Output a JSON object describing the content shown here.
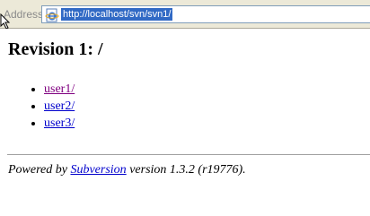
{
  "addressbar": {
    "label": "Address",
    "url": "http://localhost/svn/svn1/"
  },
  "page": {
    "title": "Revision 1: /",
    "entries": [
      {
        "label": "user1/",
        "visited": true
      },
      {
        "label": "user2/",
        "visited": false
      },
      {
        "label": "user3/",
        "visited": false
      }
    ],
    "footer": {
      "prefix": "Powered by ",
      "link": "Subversion",
      "suffix": " version 1.3.2 (r19776)."
    }
  },
  "colors": {
    "link": "#0000cc",
    "visited_link": "#800080",
    "url_highlight": "#316ac5",
    "toolbar_bg": "#ece9d8"
  },
  "icons": {
    "browser": "ie-page-icon",
    "pointer": "mouse-cursor-icon"
  }
}
